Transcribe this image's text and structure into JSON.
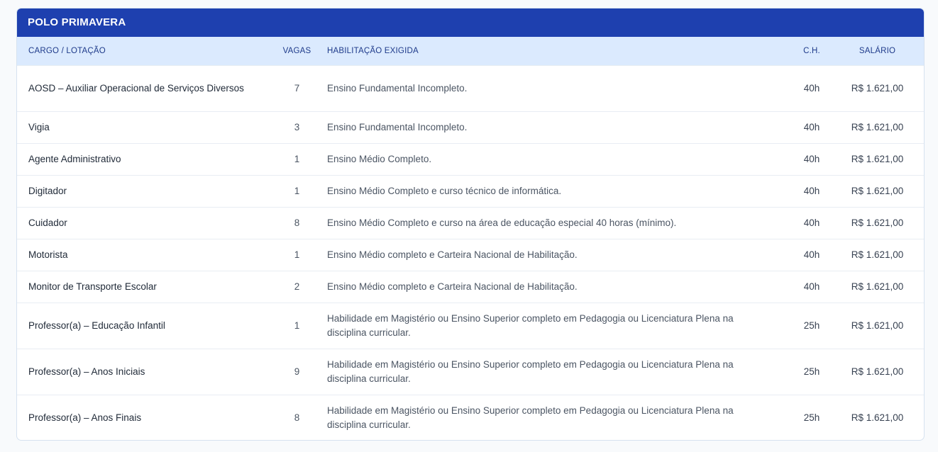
{
  "card": {
    "title": "POLO PRIMAVERA"
  },
  "table": {
    "headers": {
      "cargo": "CARGO / LOTAÇÃO",
      "vagas": "VAGAS",
      "habilitacao": "HABILITAÇÃO EXIGIDA",
      "ch": "C.H.",
      "salario": "SALÁRIO"
    },
    "rows": [
      {
        "cargo": "AOSD – Auxiliar Operacional de Serviços Diversos",
        "vagas": "7",
        "habilitacao": "Ensino Fundamental Incompleto.",
        "ch": "40h",
        "salario": "R$ 1.621,00"
      },
      {
        "cargo": "Vigia",
        "vagas": "3",
        "habilitacao": "Ensino Fundamental Incompleto.",
        "ch": "40h",
        "salario": "R$ 1.621,00"
      },
      {
        "cargo": "Agente Administrativo",
        "vagas": "1",
        "habilitacao": "Ensino Médio Completo.",
        "ch": "40h",
        "salario": "R$ 1.621,00"
      },
      {
        "cargo": "Digitador",
        "vagas": "1",
        "habilitacao": "Ensino Médio Completo e curso técnico de informática.",
        "ch": "40h",
        "salario": "R$ 1.621,00"
      },
      {
        "cargo": "Cuidador",
        "vagas": "8",
        "habilitacao": "Ensino Médio Completo e curso na área de educação especial 40 horas (mínimo).",
        "ch": "40h",
        "salario": "R$ 1.621,00"
      },
      {
        "cargo": "Motorista",
        "vagas": "1",
        "habilitacao": "Ensino Médio completo e Carteira Nacional de Habilitação.",
        "ch": "40h",
        "salario": "R$ 1.621,00"
      },
      {
        "cargo": "Monitor de Transporte Escolar",
        "vagas": "2",
        "habilitacao": "Ensino Médio completo e Carteira Nacional de Habilitação.",
        "ch": "40h",
        "salario": "R$ 1.621,00"
      },
      {
        "cargo": "Professor(a) – Educação Infantil",
        "vagas": "1",
        "habilitacao": "Habilidade em Magistério ou Ensino Superior completo em Pedagogia ou Licenciatura Plena na disciplina curricular.",
        "ch": "25h",
        "salario": "R$ 1.621,00"
      },
      {
        "cargo": "Professor(a) – Anos Iniciais",
        "vagas": "9",
        "habilitacao": "Habilidade em Magistério ou Ensino Superior completo em Pedagogia ou Licenciatura Plena na disciplina curricular.",
        "ch": "25h",
        "salario": "R$ 1.621,00"
      },
      {
        "cargo": "Professor(a) – Anos Finais",
        "vagas": "8",
        "habilitacao": "Habilidade em Magistério ou Ensino Superior completo em Pedagogia ou Licenciatura Plena na disciplina curricular.",
        "ch": "25h",
        "salario": "R$ 1.621,00"
      }
    ]
  },
  "colors": {
    "header_bg": "#1e40af",
    "column_header_bg": "#dbeafe",
    "column_header_text": "#1e3a8a"
  }
}
